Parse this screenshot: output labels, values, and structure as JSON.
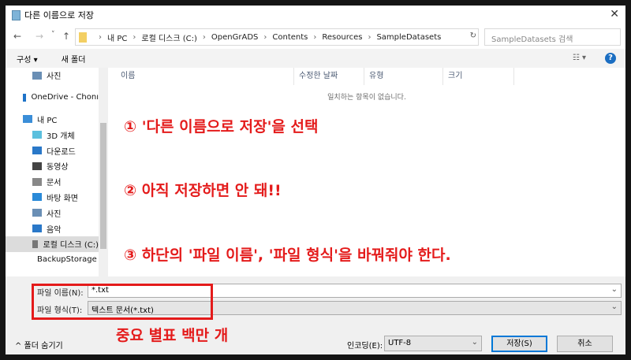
{
  "window": {
    "title": "다른 이름으로 저장",
    "close": "✕"
  },
  "nav": {
    "back": "←",
    "forward": "→",
    "recent": "˅",
    "up": "↑",
    "path": [
      "내 PC",
      "로컬 디스크 (C:)",
      "OpenGrADS",
      "Contents",
      "Resources",
      "SampleDatasets"
    ],
    "search_placeholder": "SampleDatasets 검색"
  },
  "toolbar": {
    "organize": "구성 ▾",
    "new_folder": "새 폴더",
    "help": "?"
  },
  "sidebar": {
    "items": [
      {
        "label": "사진",
        "color": "#6a8fb5"
      },
      {
        "label": "OneDrive - Chonı",
        "color": "#1e73c8"
      },
      {
        "label": "내 PC",
        "color": "#3b8ed8"
      },
      {
        "label": "3D 개체",
        "color": "#5bc0de"
      },
      {
        "label": "다운로드",
        "color": "#2a78c8"
      },
      {
        "label": "동영상",
        "color": "#444"
      },
      {
        "label": "문서",
        "color": "#888"
      },
      {
        "label": "바탕 화면",
        "color": "#2a8ad8"
      },
      {
        "label": "사진",
        "color": "#6a8fb5"
      },
      {
        "label": "음악",
        "color": "#2a78c8"
      },
      {
        "label": "로컬 디스크 (C:)",
        "color": "#777"
      },
      {
        "label": "BackupStorage (",
        "color": "#555"
      }
    ]
  },
  "columns": [
    "이름",
    "수정한 날짜",
    "유형",
    "크기"
  ],
  "empty_message": "일치하는 항목이 없습니다.",
  "annotations": [
    "① '다른 이름으로 저장'을 선택",
    "② 아직 저장하면 안 돼!!",
    "③ 하단의 '파일 이름', '파일 형식'을 바꿔줘야 한다.",
    "중요 별표 백만 개"
  ],
  "form": {
    "filename_label": "파일 이름(N):",
    "filename_value": "*.txt",
    "filetype_label": "파일 형식(T):",
    "filetype_value": "텍스트 문서(*.txt)",
    "encoding_label": "인코딩(E):",
    "encoding_value": "UTF-8",
    "hide_folders": "^  폴더 숨기기",
    "save": "저장(S)",
    "cancel": "취소"
  }
}
